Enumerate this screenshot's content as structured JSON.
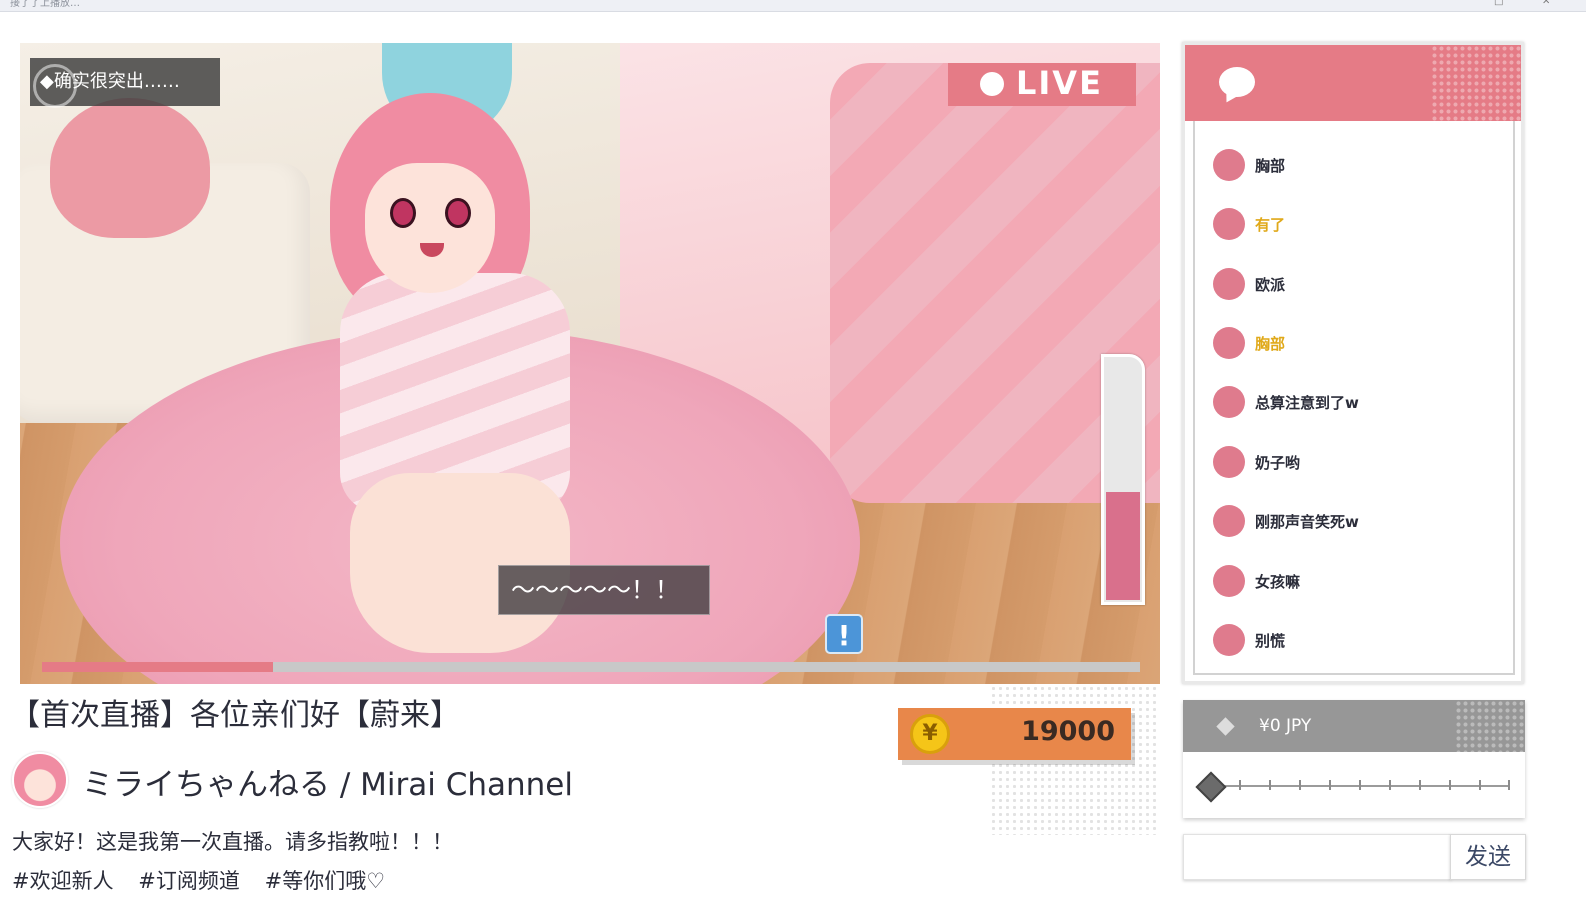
{
  "window": {
    "title": "接了了上播放…"
  },
  "stage": {
    "objective": "◆确实很突出……",
    "live_label": "LIVE",
    "speech": "～～～～～！！",
    "alert_symbol": "!",
    "excitement_level": 0.44,
    "stream_progress": 0.21
  },
  "stream": {
    "title": "【首次直播】各位亲们好【蔚来】",
    "channel": "ミライちゃんねる / Mirai Channel",
    "description": "大家好！这是我第一次直播。请多指教啦！！！",
    "tags": [
      "#欢迎新人",
      "#订阅频道",
      "#等你们哦♡"
    ]
  },
  "wallet": {
    "coin_symbol": "¥",
    "amount": "19000"
  },
  "chat": {
    "icon": "speech-bubble-icon",
    "messages": [
      {
        "text": "胸部",
        "color": "#2b2d3a"
      },
      {
        "text": "有了",
        "color": "#e0a91a"
      },
      {
        "text": "欧派",
        "color": "#2b2d3a"
      },
      {
        "text": "胸部",
        "color": "#e0a91a"
      },
      {
        "text": "总算注意到了w",
        "color": "#2b2d3a"
      },
      {
        "text": "奶子哟",
        "color": "#2b2d3a"
      },
      {
        "text": "刚那声音笑死w",
        "color": "#2b2d3a"
      },
      {
        "text": "女孩嘛",
        "color": "#2b2d3a"
      },
      {
        "text": "别慌",
        "color": "#2b2d3a"
      }
    ]
  },
  "tip": {
    "amount_label": "¥0 JPY",
    "value": 0
  },
  "input": {
    "placeholder": "",
    "send_label": "发送"
  },
  "colors": {
    "accent": "#e57b86",
    "coin": "#e8874a",
    "meter": "#d9708c"
  }
}
